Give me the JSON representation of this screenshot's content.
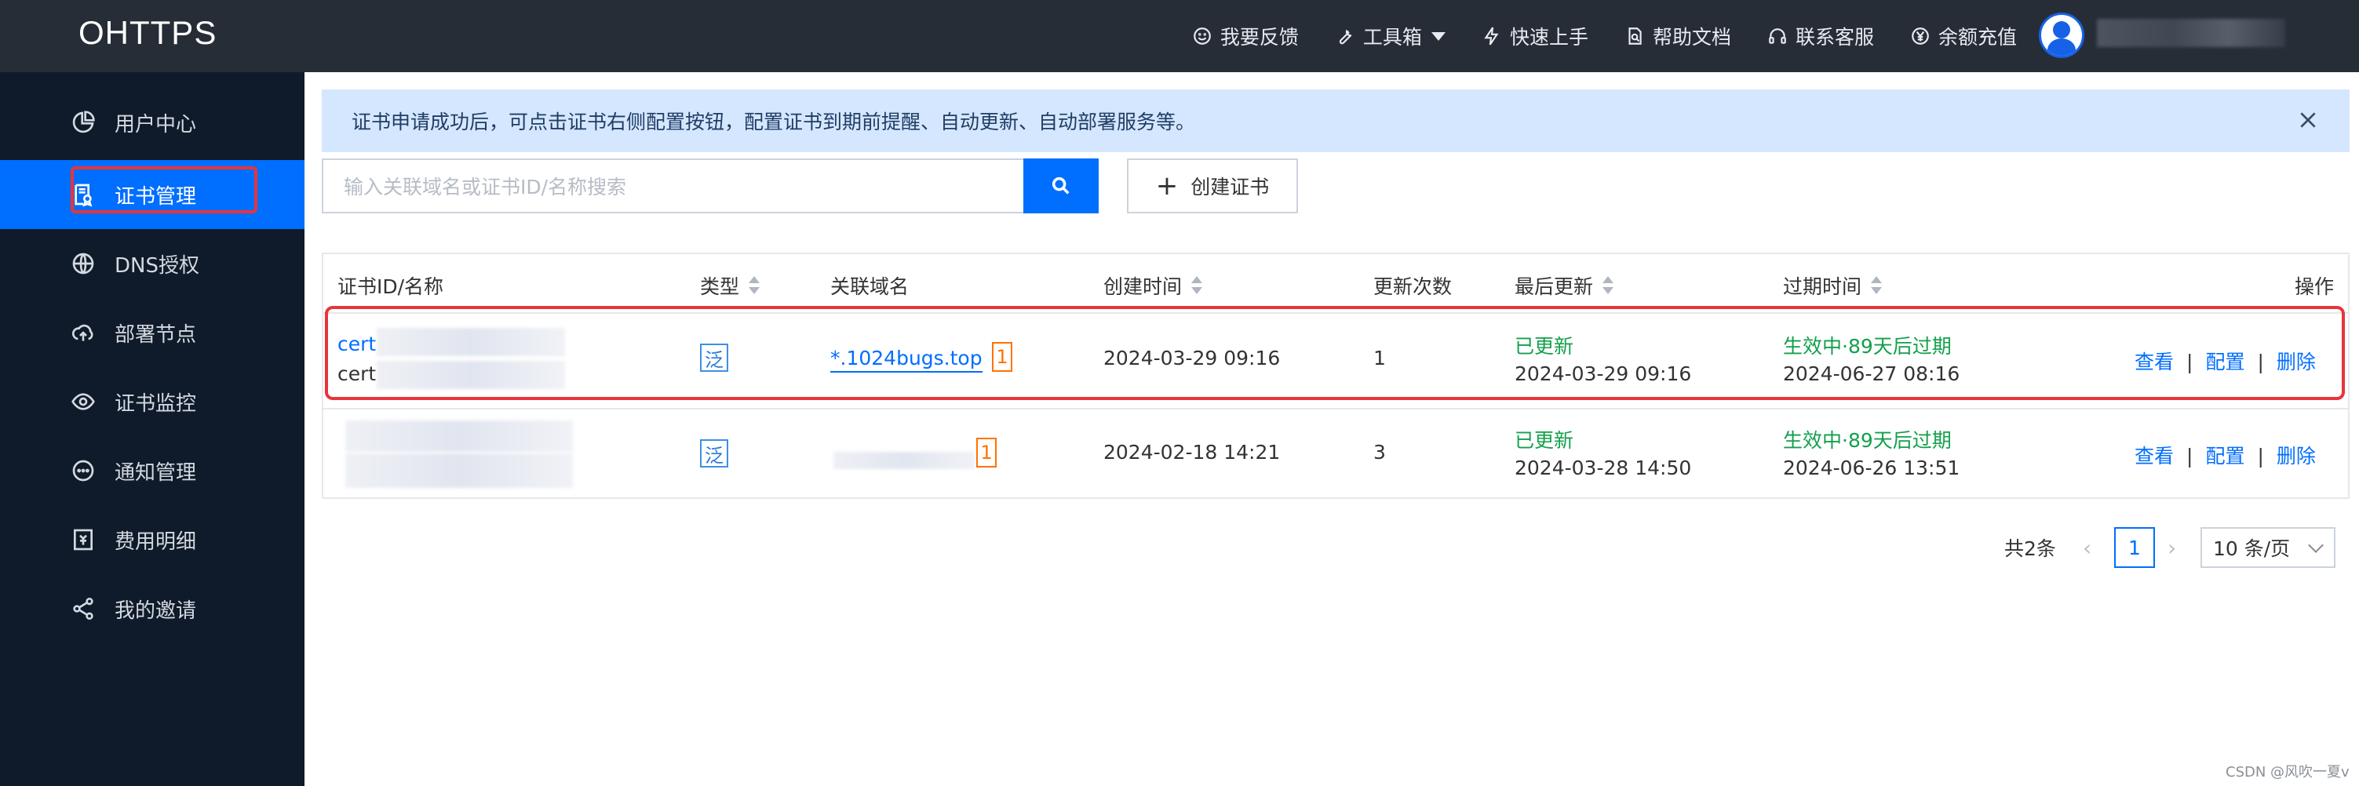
{
  "topbar": {
    "logo": "OHTTPS",
    "nav": [
      {
        "label": "我要反馈",
        "icon": "smile-icon"
      },
      {
        "label": "工具箱",
        "icon": "wrench-icon"
      },
      {
        "label": "快速上手",
        "icon": "lightning-icon"
      },
      {
        "label": "帮助文档",
        "icon": "document-search-icon"
      },
      {
        "label": "联系客服",
        "icon": "headset-icon"
      },
      {
        "label": "余额充值",
        "icon": "yen-icon"
      }
    ]
  },
  "sidebar": {
    "items": [
      {
        "label": "用户中心",
        "icon": "pie-chart-icon"
      },
      {
        "label": "证书管理",
        "icon": "certificate-icon",
        "active": true
      },
      {
        "label": "DNS授权",
        "icon": "globe-icon"
      },
      {
        "label": "部署节点",
        "icon": "cloud-upload-icon"
      },
      {
        "label": "证书监控",
        "icon": "eye-icon"
      },
      {
        "label": "通知管理",
        "icon": "chat-bubble-icon"
      },
      {
        "label": "费用明细",
        "icon": "bill-icon"
      },
      {
        "label": "我的邀请",
        "icon": "share-icon"
      }
    ]
  },
  "notice": {
    "text": "证书申请成功后，可点击证书右侧配置按钮，配置证书到期前提醒、自动更新、自动部署服务等。"
  },
  "search": {
    "placeholder": "输入关联域名或证书ID/名称搜索",
    "create_label": "创建证书"
  },
  "table": {
    "headers": {
      "id_name": "证书ID/名称",
      "type": "类型",
      "domain": "关联域名",
      "created": "创建时间",
      "renew_count": "更新次数",
      "last_update": "最后更新",
      "expire": "过期时间",
      "actions": "操作"
    },
    "rows": [
      {
        "id": "cert",
        "name": "cert",
        "type": "泛",
        "domain": "*.1024bugs.top",
        "domain_count": "1",
        "created": "2024-03-29 09:16",
        "renew_count": "1",
        "last_status": "已更新",
        "last_time": "2024-03-29 09:16",
        "expire_status": "生效中·89天后过期",
        "expire_time": "2024-06-27 08:16"
      },
      {
        "id": "",
        "name": "",
        "type": "泛",
        "domain": "",
        "domain_count": "1",
        "created": "2024-02-18 14:21",
        "renew_count": "3",
        "last_status": "已更新",
        "last_time": "2024-03-28 14:50",
        "expire_status": "生效中·89天后过期",
        "expire_time": "2024-06-26 13:51"
      }
    ],
    "actions": {
      "view": "查看",
      "config": "配置",
      "delete": "删除",
      "sep": "|"
    }
  },
  "pagination": {
    "total": "共2条",
    "current_page": "1",
    "page_size": "10 条/页"
  },
  "watermark": "CSDN @风吹一夏v",
  "colors": {
    "accent": "#006eff",
    "highlight": "#e8343b",
    "success": "#0abf5b",
    "badge_orange": "#ff7200"
  }
}
